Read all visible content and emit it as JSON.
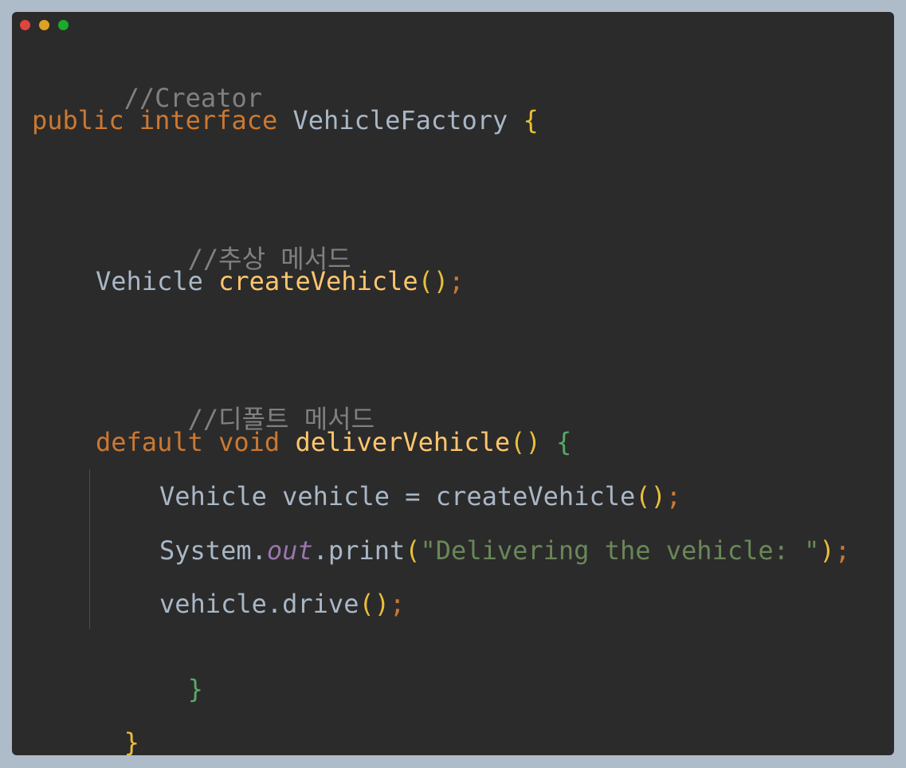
{
  "window": {
    "controls": [
      "close",
      "minimize",
      "maximize"
    ]
  },
  "code": {
    "line1_comment": "//Creator",
    "line2_keyword1": "public",
    "line2_keyword2": "interface",
    "line2_type": "VehicleFactory",
    "line2_brace": "{",
    "line3_comment": "//추상 메서드",
    "line4_type": "Vehicle",
    "line4_method": "createVehicle",
    "line4_paren": "()",
    "line4_semi": ";",
    "line5_comment": "//디폴트 메서드",
    "line6_keyword1": "default",
    "line6_keyword2": "void",
    "line6_method": "deliverVehicle",
    "line6_paren": "()",
    "line6_brace": "{",
    "line7_type": "Vehicle",
    "line7_var": "vehicle",
    "line7_eq": "=",
    "line7_call": "createVehicle",
    "line7_paren": "()",
    "line7_semi": ";",
    "line8_class": "System",
    "line8_dot1": ".",
    "line8_field": "out",
    "line8_dot2": ".",
    "line8_method": "print",
    "line8_lparen": "(",
    "line8_string": "\"Delivering the vehicle: \"",
    "line8_rparen": ")",
    "line8_semi": ";",
    "line9_obj": "vehicle",
    "line9_dot": ".",
    "line9_method": "drive",
    "line9_paren": "()",
    "line9_semi": ";",
    "line10_brace": "}",
    "line11_brace": "}"
  },
  "colors": {
    "background": "#2b2b2b",
    "outer": "#aebbc9",
    "comment": "#808080",
    "keyword": "#cc7832",
    "method": "#ffc66d",
    "string": "#6a8759",
    "field": "#9876aa"
  }
}
